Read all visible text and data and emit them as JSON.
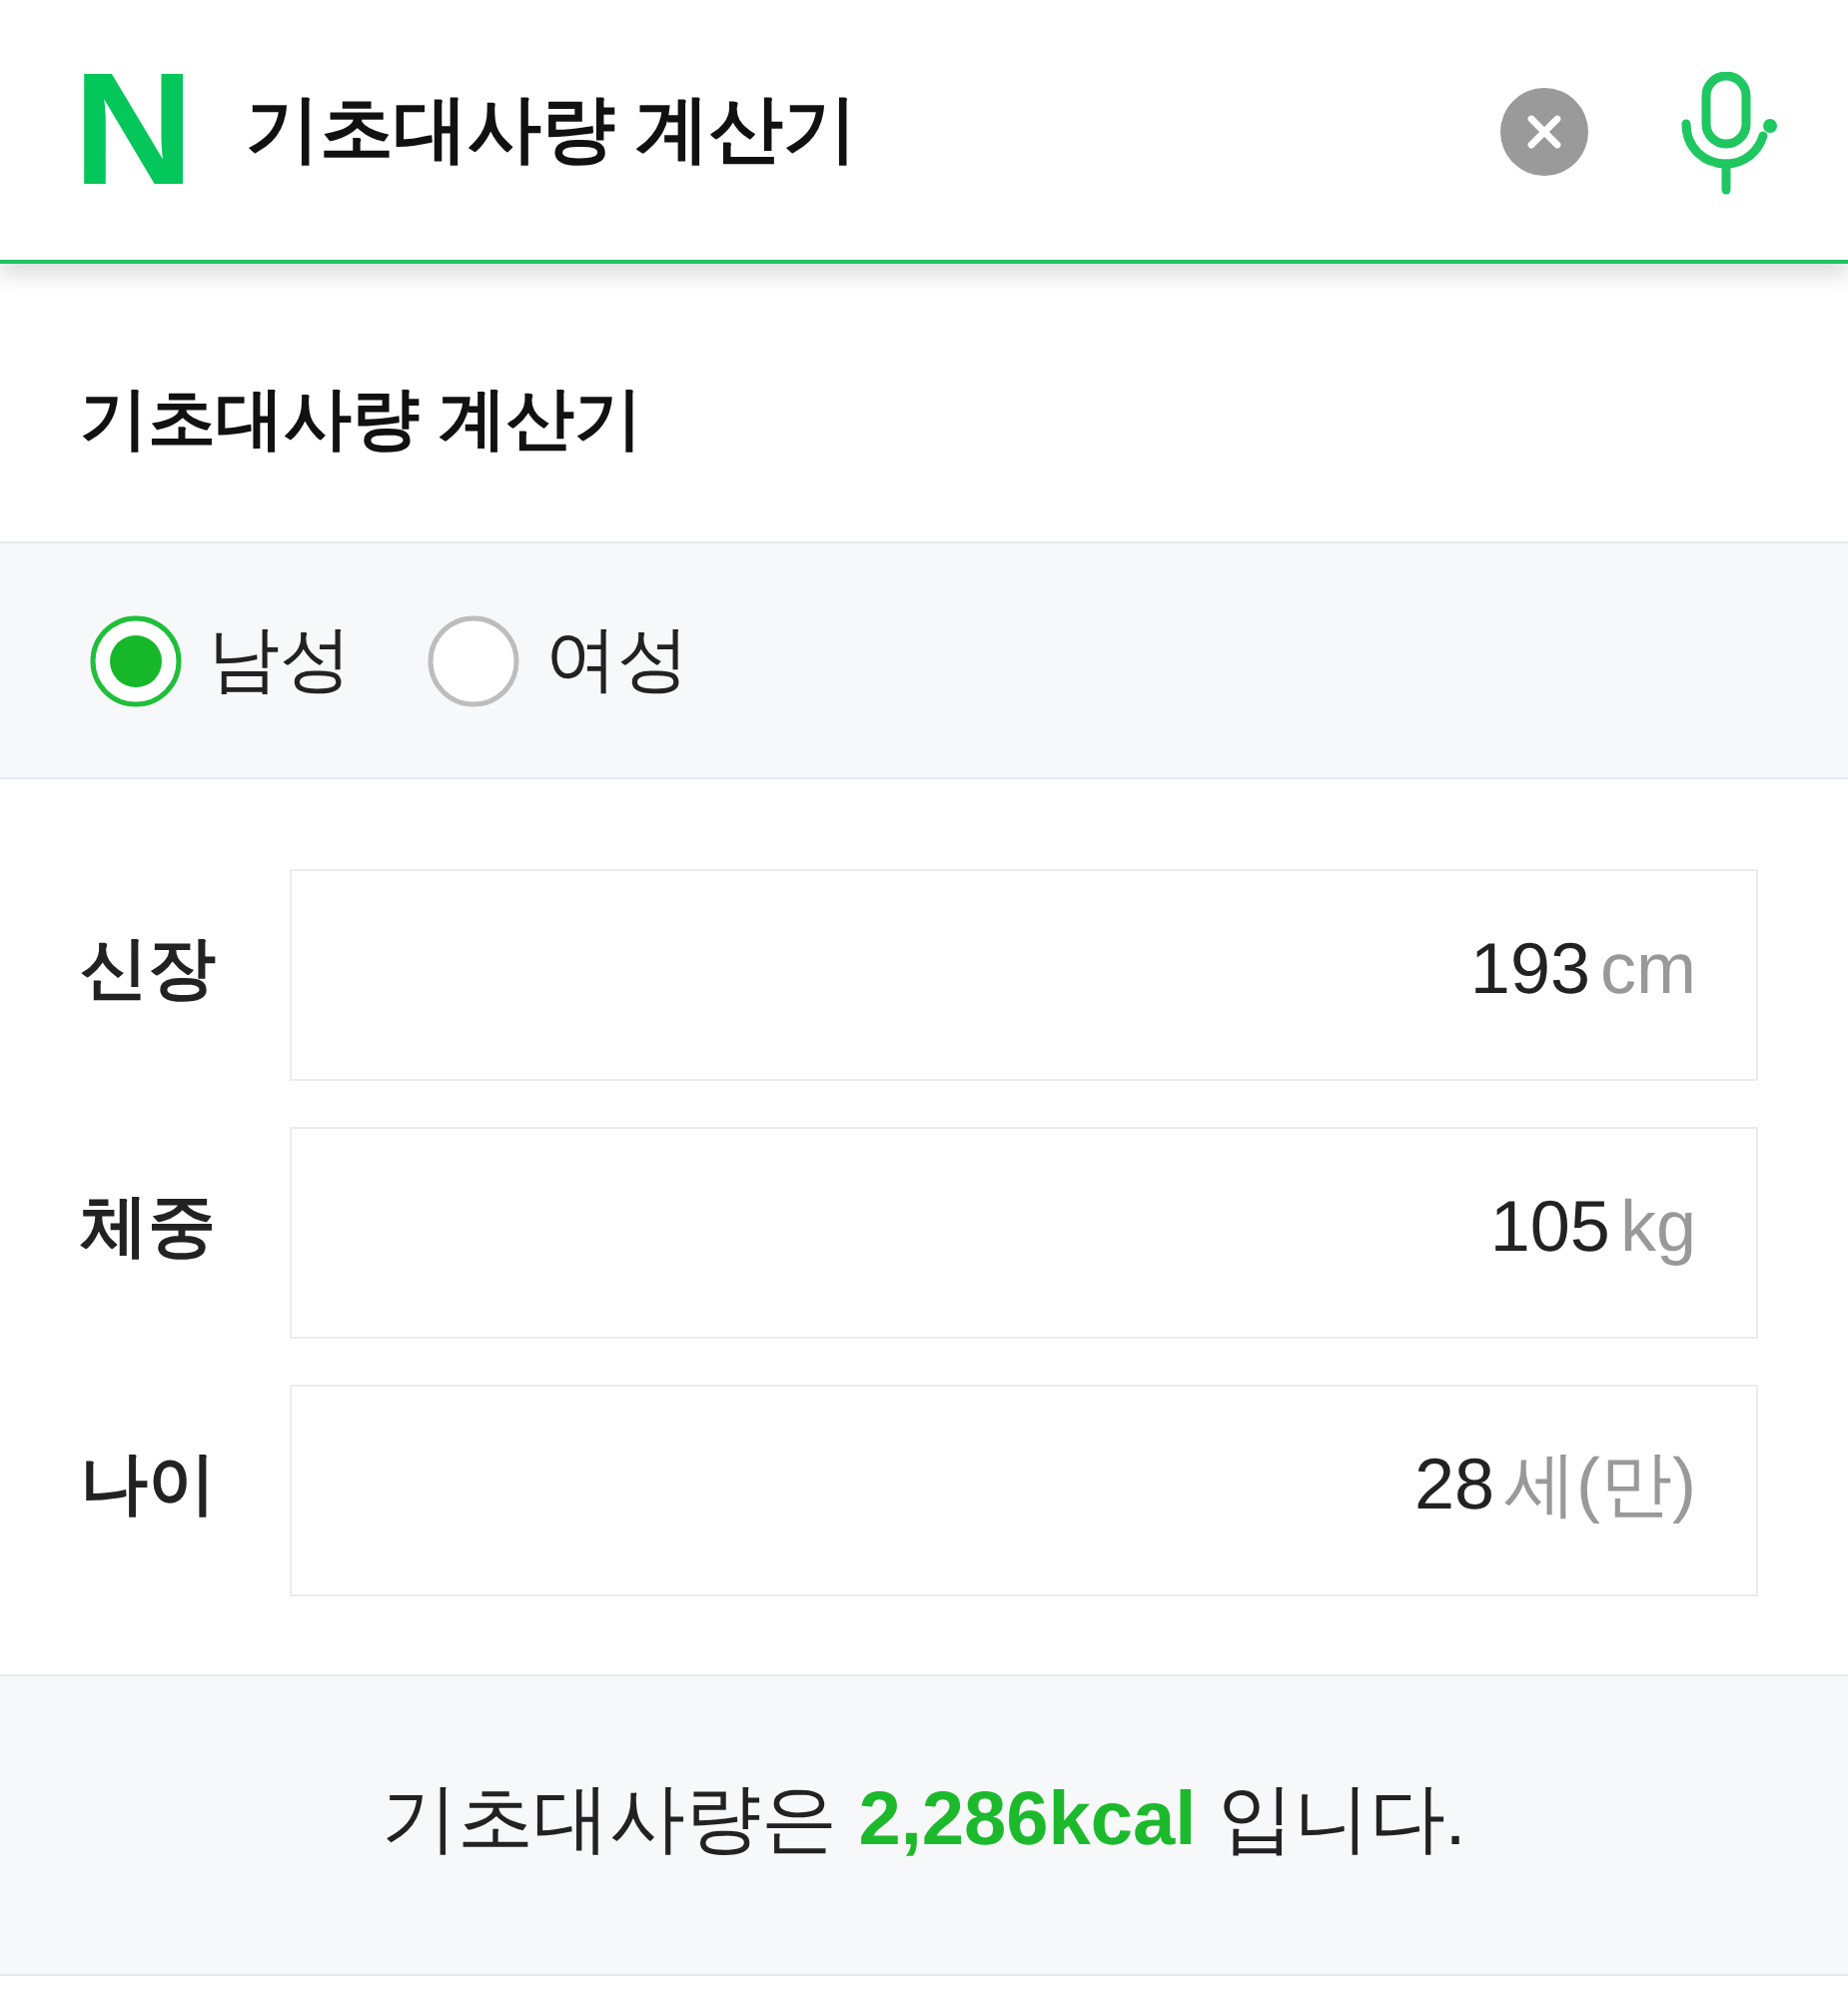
{
  "search": {
    "logo": "N",
    "query": "기초대사량 계산기"
  },
  "title": "기초대사량 계산기",
  "gender_options": [
    {
      "label": "남성",
      "selected": true
    },
    {
      "label": "여성",
      "selected": false
    }
  ],
  "fields": [
    {
      "label": "신장",
      "value": "193",
      "unit": "cm"
    },
    {
      "label": "체중",
      "value": "105",
      "unit": "kg"
    },
    {
      "label": "나이",
      "value": "28",
      "unit": "세(만)"
    }
  ],
  "result": "기초대사량은 **2,286kcal** 입니다."
}
